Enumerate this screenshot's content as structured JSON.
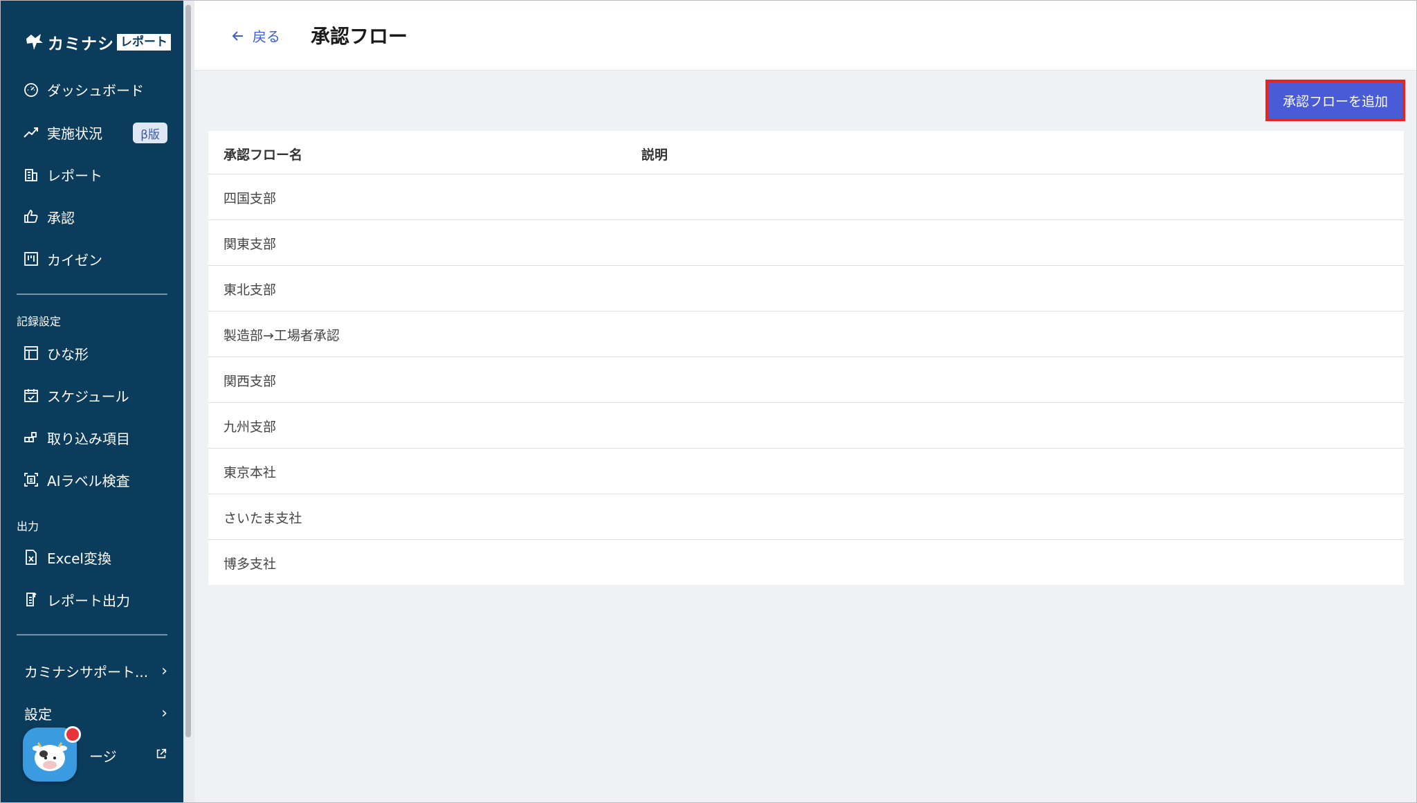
{
  "app": {
    "logo_text": "カミナシ",
    "logo_badge": "レポート"
  },
  "sidebar": {
    "main_items": [
      {
        "label": "ダッシュボード",
        "icon": "dashboard-gauge-icon"
      },
      {
        "label": "実施状況",
        "icon": "trend-chart-icon",
        "badge": "β版"
      },
      {
        "label": "レポート",
        "icon": "report-building-icon"
      },
      {
        "label": "承認",
        "icon": "thumbs-up-icon"
      },
      {
        "label": "カイゼン",
        "icon": "kaizen-board-icon"
      }
    ],
    "record_settings": {
      "heading": "記録設定",
      "items": [
        {
          "label": "ひな形",
          "icon": "template-icon"
        },
        {
          "label": "スケジュール",
          "icon": "calendar-icon"
        },
        {
          "label": "取り込み項目",
          "icon": "import-blocks-icon"
        },
        {
          "label": "AIラベル検査",
          "icon": "ai-scan-icon"
        }
      ]
    },
    "output": {
      "heading": "出力",
      "items": [
        {
          "label": "Excel変換",
          "icon": "excel-file-icon"
        },
        {
          "label": "レポート出力",
          "icon": "report-export-icon"
        }
      ]
    },
    "bottom_items": [
      {
        "label": "カミナシサポート...",
        "icon": "chevron-right-icon"
      },
      {
        "label": "設定",
        "icon": "chevron-right-icon"
      },
      {
        "label": "ージ",
        "icon": "external-link-icon"
      }
    ]
  },
  "header": {
    "back_label": "戻る",
    "title": "承認フロー"
  },
  "toolbar": {
    "add_label": "承認フローを追加"
  },
  "table": {
    "columns": [
      "承認フロー名",
      "説明"
    ],
    "rows": [
      {
        "name": "四国支部",
        "description": ""
      },
      {
        "name": "関東支部",
        "description": ""
      },
      {
        "name": "東北支部",
        "description": ""
      },
      {
        "name": "製造部→工場者承認",
        "description": ""
      },
      {
        "name": "関西支部",
        "description": ""
      },
      {
        "name": "九州支部",
        "description": ""
      },
      {
        "name": "東京本社",
        "description": ""
      },
      {
        "name": "さいたま支社",
        "description": ""
      },
      {
        "name": "博多支社",
        "description": ""
      }
    ]
  },
  "colors": {
    "sidebar_bg": "#0c3c5c",
    "primary": "#4a5bd8",
    "highlight": "#e8241d",
    "main_bg": "#f0f1f5"
  }
}
